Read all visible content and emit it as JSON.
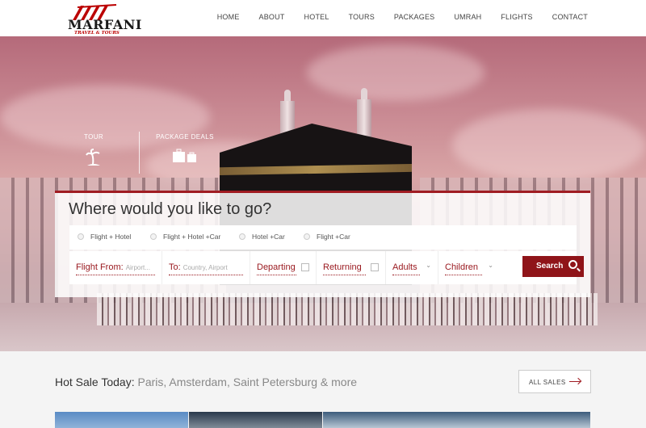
{
  "brand": {
    "name": "MARFANI",
    "tagline": "TRAVEL & TOURS",
    "accent": "#a01c22"
  },
  "nav": {
    "items": [
      "HOME",
      "ABOUT",
      "HOTEL",
      "TOURS",
      "PACKAGES",
      "UMRAH",
      "FLIGHTS",
      "CONTACT"
    ]
  },
  "hero_tabs": [
    {
      "label": "TOUR",
      "icon": "palm-tree-icon"
    },
    {
      "label": "PACKAGE DEALS",
      "icon": "luggage-icon"
    }
  ],
  "search": {
    "title": "Where would you like to go?",
    "options": [
      "Flight + Hotel",
      "Flight + Hotel +Car",
      "Hotel +Car",
      "Flight +Car"
    ],
    "fields": {
      "from_label": "Flight From:",
      "from_placeholder": "Airport...",
      "to_label": "To:",
      "to_placeholder": "Country, Airport",
      "departing": "Departing",
      "returning": "Returning",
      "adults": "Adults",
      "children": "Children"
    },
    "button": "Search"
  },
  "hot_sale": {
    "lead": "Hot Sale Today:",
    "places": "Paris, Amsterdam, Saint Petersburg & more",
    "all_sales": "ALL SALES"
  }
}
